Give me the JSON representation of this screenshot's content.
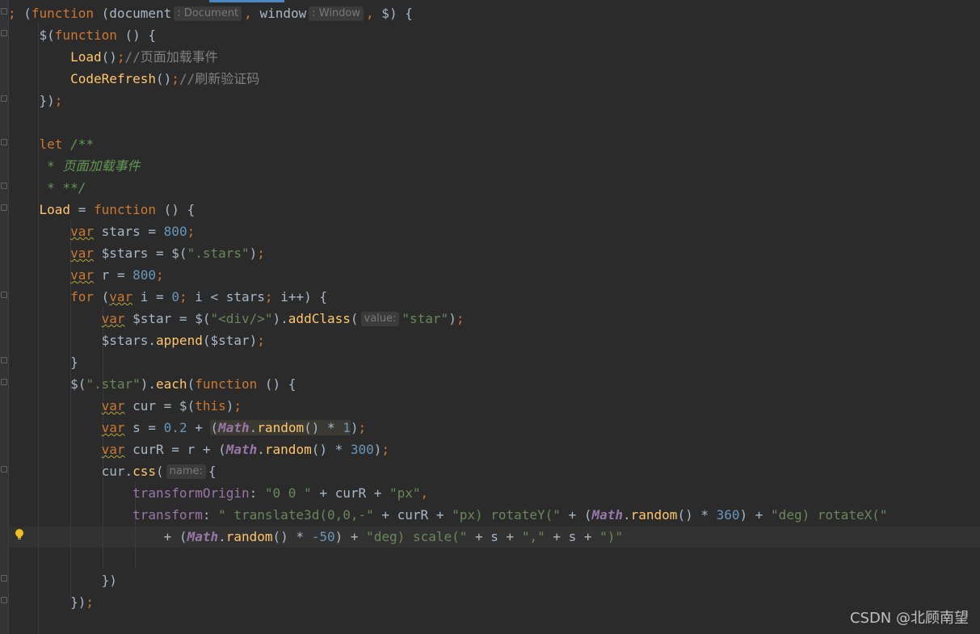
{
  "hints": {
    "document": ": Document",
    "window": ": Window",
    "value": "value:",
    "name": "name:"
  },
  "comments": {
    "load": "//页面加载事件",
    "refresh": "//刷新验证码",
    "doc_open": "/**",
    "doc_body": "* 页面加载事件",
    "doc_close": "* **/"
  },
  "strings": {
    "stars_selector": "\".stars\"",
    "div": "\"<div/>\"",
    "star": "\"star\"",
    "star_selector": "\".star\"",
    "origin": "\"0 0 \"",
    "px": "\"px\"",
    "translate": "\" translate3d(0,0,-\"",
    "px_rotate": "\"px) rotateY(\"",
    "deg_rotate": "\"deg) rotateX(\"",
    "deg_scale": "\"deg) scale(\"",
    "comma": "\",\"",
    "close": "\")\""
  },
  "numbers": {
    "stars": "800",
    "r": "800",
    "zero": "0",
    "s_base": "0.2",
    "one": "1",
    "three_hundred": "300",
    "three_sixty": "360",
    "neg_fifty": "-50"
  },
  "watermark": "CSDN @北顾南望",
  "colors": {
    "background": "#2b2b2b",
    "keyword": "#cc7832",
    "function": "#ffc66d",
    "string": "#6a8759",
    "number": "#6897bb"
  }
}
